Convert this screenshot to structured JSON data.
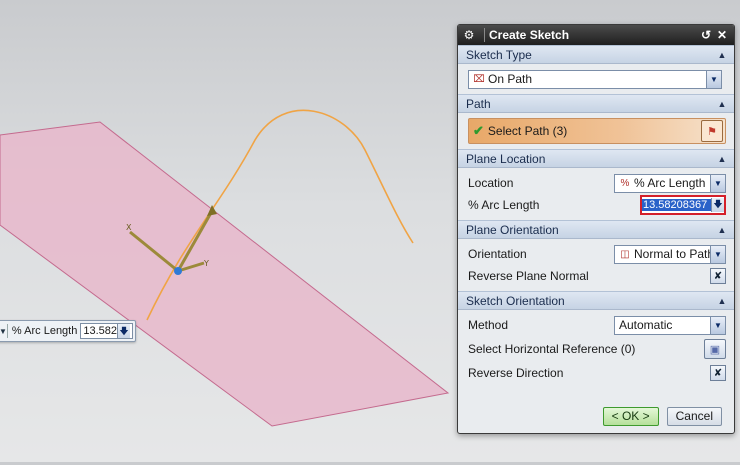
{
  "floating_input": {
    "label": "% Arc Length",
    "value": "13.582"
  },
  "dialog": {
    "title": "Create Sketch",
    "groups": {
      "sketch_type": {
        "header": "Sketch Type",
        "selected": "On Path"
      },
      "path": {
        "header": "Path",
        "select_label": "Select Path (3)"
      },
      "plane_location": {
        "header": "Plane Location",
        "location_label": "Location",
        "location_value": "% Arc Length",
        "arc_length_label": "% Arc Length",
        "arc_length_value": "13.58208367"
      },
      "plane_orientation": {
        "header": "Plane Orientation",
        "orientation_label": "Orientation",
        "orientation_value": "Normal to Path",
        "reverse_label": "Reverse Plane Normal"
      },
      "sketch_orientation": {
        "header": "Sketch Orientation",
        "method_label": "Method",
        "method_value": "Automatic",
        "horizontal_ref_label": "Select Horizontal Reference (0)",
        "reverse_direction_label": "Reverse Direction"
      }
    },
    "buttons": {
      "ok": "< OK >",
      "cancel": "Cancel"
    }
  },
  "colors": {
    "plane_fill": "#e8b9cb",
    "plane_edge": "#c46a8e",
    "path_curve": "#f0a445",
    "highlight_border": "#d4202a",
    "selection_blue": "#2a62c9"
  }
}
